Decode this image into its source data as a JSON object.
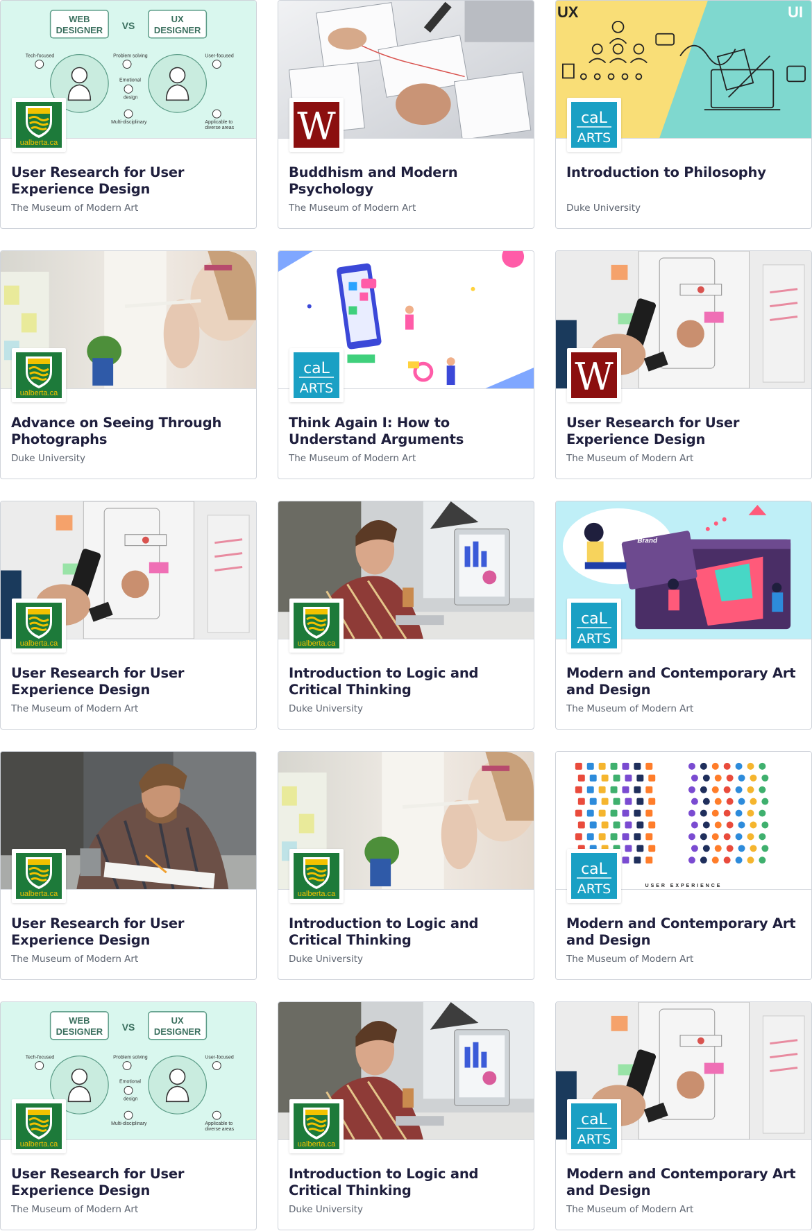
{
  "courses": [
    {
      "title": "User Research for User Experience Design",
      "partner": "The Museum of Modern Art",
      "image": "web-vs-ux-illustration",
      "logo": "ualberta"
    },
    {
      "title": "Buddhism and Modern Psychology",
      "partner": "The Museum of Modern Art",
      "image": "wireframe-sketch-photo",
      "logo": "w-logo"
    },
    {
      "title": "Introduction to Philosophy",
      "partner": "Duke University",
      "image": "ux-ui-illustration",
      "logo": "calarts"
    },
    {
      "title": "Advance on Seeing Through Photographs",
      "partner": "Duke University",
      "image": "woman-thinking-photo",
      "logo": "ualberta"
    },
    {
      "title": "Think Again I: How to Understand Arguments",
      "partner": "The Museum of Modern Art",
      "image": "app-design-illustration",
      "logo": "calarts"
    },
    {
      "title": "User Research for User Experience Design",
      "partner": "The Museum of Modern Art",
      "image": "phone-wireframe-photo",
      "logo": "w-logo"
    },
    {
      "title": "User Research for User Experience Design",
      "partner": "The Museum of Modern Art",
      "image": "phone-wireframe-photo",
      "logo": "ualberta"
    },
    {
      "title": "Introduction to Logic and Critical Thinking",
      "partner": "Duke University",
      "image": "man-computer-photo",
      "logo": "ualberta"
    },
    {
      "title": "Modern and Contemporary Art and Design",
      "partner": "The Museum of Modern Art",
      "image": "brand-design-illustration",
      "logo": "calarts"
    },
    {
      "title": "User Research for User Experience Design",
      "partner": "The Museum of Modern Art",
      "image": "man-drawing-photo",
      "logo": "ualberta"
    },
    {
      "title": "Introduction to Logic and Critical Thinking",
      "partner": "Duke University",
      "image": "woman-thinking-photo",
      "logo": "ualberta"
    },
    {
      "title": "Modern and Contemporary Art and Design",
      "partner": "The Museum of Modern Art",
      "image": "ux-icons-illustration",
      "logo": "calarts"
    },
    {
      "title": "User Research for User Experience Design",
      "partner": "The Museum of Modern Art",
      "image": "web-vs-ux-illustration",
      "logo": "ualberta"
    },
    {
      "title": "Introduction to Logic and Critical Thinking",
      "partner": "Duke University",
      "image": "man-computer-photo",
      "logo": "ualberta"
    },
    {
      "title": "Modern and Contemporary Art and Design",
      "partner": "The Museum of Modern Art",
      "image": "phone-wireframe-photo",
      "logo": "calarts"
    }
  ],
  "logo_text": {
    "ualberta": "ualberta.ca",
    "calarts_top": "caL",
    "calarts_bottom": "ARTS",
    "w_logo": "W"
  },
  "illustration_text": {
    "web_designer_1": "WEB",
    "web_designer_2": "DESIGNER",
    "vs": "VS",
    "ux_designer_1": "UX",
    "ux_designer_2": "DESIGNER",
    "tech_focused": "Tech-focused",
    "problem_solving": "Problem solving",
    "user_focused": "User-focused",
    "emotional_design_1": "Emotional",
    "emotional_design_2": "design",
    "multi_disciplinary": "Multi-disciplinary",
    "applicable_1": "Applicable to",
    "applicable_2": "diverse areas",
    "ux_label": "UX",
    "ui_label": "UI",
    "brand_label": "Brand",
    "user_experience": "USER EXPERIENCE"
  },
  "colors": {
    "title": "#1f1f3d",
    "partner": "#5d6470",
    "ualberta_green": "#1d7a3a",
    "ualberta_gold": "#f2c200",
    "calarts_teal": "#1aa0c4",
    "w_red": "#8b0f0f",
    "mint": "#d9f7ee"
  }
}
